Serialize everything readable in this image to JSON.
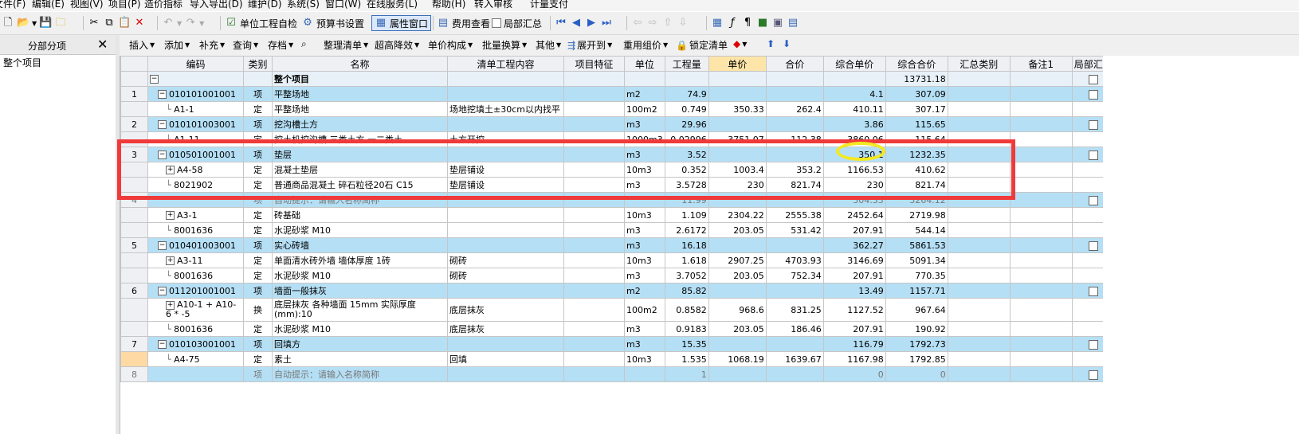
{
  "menu": [
    "文件(F)",
    "编辑(E)",
    "视图(V)",
    "项目(P)",
    "造价指标",
    "导入导出(D)",
    "维护(D)",
    "系统(S)",
    "窗口(W)",
    "在线服务(L)",
    "帮助(H)",
    "转入审核",
    "计量支付"
  ],
  "toolbar": {
    "self_check": "单位工程自检",
    "budget_settings": "预算书设置",
    "property_window": "属性窗口",
    "cost_view": "费用查看",
    "local_summary": "局部汇总"
  },
  "toolbar2": {
    "insert": "插入",
    "add": "添加",
    "supplement": "补充",
    "query": "查询",
    "save": "存档",
    "organize": "整理清单",
    "height_reduce": "超高降效",
    "unit_price_comp": "单价构成",
    "batch_convert": "批量换算",
    "other": "其他",
    "expand": "展开到",
    "reuse_price": "重用组价",
    "lock_list": "锁定清单"
  },
  "left_pane": {
    "title": "分部分项",
    "close": "✕",
    "item": "整个项目"
  },
  "columns": [
    "",
    "编码",
    "类别",
    "名称",
    "清单工程内容",
    "项目特征",
    "单位",
    "工程量",
    "单价",
    "合价",
    "综合单价",
    "综合合价",
    "汇总类别",
    "备注1",
    "局部汇总"
  ],
  "rows": [
    {
      "no": "",
      "code": "",
      "type": "",
      "name": "整个项目",
      "content": "",
      "feature": "",
      "unit": "",
      "qty": "",
      "price": "",
      "total": "",
      "comp_price": "",
      "comp_total": "13731.18"
    },
    {
      "no": "1",
      "code": "010101001001",
      "type": "项",
      "name": "平整场地",
      "content": "",
      "feature": "",
      "unit": "m2",
      "qty": "74.9",
      "price": "",
      "total": "",
      "comp_price": "4.1",
      "comp_total": "307.09"
    },
    {
      "no": "",
      "code": "A1-1",
      "type": "定",
      "name": "平整场地",
      "content": "场地挖填土±30cm以内找平",
      "feature": "",
      "unit": "100m2",
      "qty": "0.749",
      "price": "350.33",
      "total": "262.4",
      "comp_price": "410.11",
      "comp_total": "307.17"
    },
    {
      "no": "2",
      "code": "010101003001",
      "type": "项",
      "name": "挖沟槽土方",
      "content": "",
      "feature": "",
      "unit": "m3",
      "qty": "29.96",
      "price": "",
      "total": "",
      "comp_price": "3.86",
      "comp_total": "115.65"
    },
    {
      "no": "",
      "code": "A1-11",
      "type": "定",
      "name": "挖土机挖沟槽 三类土方 一二类土",
      "content": "土方开挖",
      "feature": "",
      "unit": "1000m3",
      "qty": "0.02996",
      "price": "3751.07",
      "total": "112.38",
      "comp_price": "3860.06",
      "comp_total": "115.64"
    },
    {
      "no": "3",
      "code": "010501001001",
      "type": "项",
      "name": "垫层",
      "content": "",
      "feature": "",
      "unit": "m3",
      "qty": "3.52",
      "price": "",
      "total": "",
      "comp_price": "350.1",
      "comp_total": "1232.35"
    },
    {
      "no": "",
      "code": "A4-58",
      "type": "定",
      "name": "混凝土垫层",
      "content": "垫层铺设",
      "feature": "",
      "unit": "10m3",
      "qty": "0.352",
      "price": "1003.4",
      "total": "353.2",
      "comp_price": "1166.53",
      "comp_total": "410.62"
    },
    {
      "no": "",
      "code": "8021902",
      "type": "定",
      "name": "普通商品混凝土 碎石粒径20石 C15",
      "content": "垫层铺设",
      "feature": "",
      "unit": "m3",
      "qty": "3.5728",
      "price": "230",
      "total": "821.74",
      "comp_price": "230",
      "comp_total": "821.74"
    },
    {
      "no": "4",
      "code": "",
      "type": "项",
      "name": "自动提示：请输入名称简称",
      "content": "",
      "feature": "",
      "unit": "",
      "qty": "11.99",
      "price": "",
      "total": "",
      "comp_price": "304.33",
      "comp_total": "3264.12"
    },
    {
      "no": "",
      "code": "A3-1",
      "type": "定",
      "name": "砖基础",
      "content": "",
      "feature": "",
      "unit": "10m3",
      "qty": "1.109",
      "price": "2304.22",
      "total": "2555.38",
      "comp_price": "2452.64",
      "comp_total": "2719.98"
    },
    {
      "no": "",
      "code": "8001636",
      "type": "定",
      "name": "水泥砂浆 M10",
      "content": "",
      "feature": "",
      "unit": "m3",
      "qty": "2.6172",
      "price": "203.05",
      "total": "531.42",
      "comp_price": "207.91",
      "comp_total": "544.14"
    },
    {
      "no": "5",
      "code": "010401003001",
      "type": "项",
      "name": "实心砖墙",
      "content": "",
      "feature": "",
      "unit": "m3",
      "qty": "16.18",
      "price": "",
      "total": "",
      "comp_price": "362.27",
      "comp_total": "5861.53"
    },
    {
      "no": "",
      "code": "A3-11",
      "type": "定",
      "name": "单面清水砖外墙 墙体厚度 1砖",
      "content": "砌砖",
      "feature": "",
      "unit": "10m3",
      "qty": "1.618",
      "price": "2907.25",
      "total": "4703.93",
      "comp_price": "3146.69",
      "comp_total": "5091.34"
    },
    {
      "no": "",
      "code": "8001636",
      "type": "定",
      "name": "水泥砂浆 M10",
      "content": "砌砖",
      "feature": "",
      "unit": "m3",
      "qty": "3.7052",
      "price": "203.05",
      "total": "752.34",
      "comp_price": "207.91",
      "comp_total": "770.35"
    },
    {
      "no": "6",
      "code": "011201001001",
      "type": "项",
      "name": "墙面一般抹灰",
      "content": "",
      "feature": "",
      "unit": "m2",
      "qty": "85.82",
      "price": "",
      "total": "",
      "comp_price": "13.49",
      "comp_total": "1157.71"
    },
    {
      "no": "",
      "code": "A10-1 + A10-6 * -5",
      "type": "换",
      "name": "底层抹灰 各种墙面 15mm 实际厚度(mm):10",
      "content": "底层抹灰",
      "feature": "",
      "unit": "100m2",
      "qty": "0.8582",
      "price": "968.6",
      "total": "831.25",
      "comp_price": "1127.52",
      "comp_total": "967.64"
    },
    {
      "no": "",
      "code": "8001636",
      "type": "定",
      "name": "水泥砂浆 M10",
      "content": "底层抹灰",
      "feature": "",
      "unit": "m3",
      "qty": "0.9183",
      "price": "203.05",
      "total": "186.46",
      "comp_price": "207.91",
      "comp_total": "190.92"
    },
    {
      "no": "7",
      "code": "010103001001",
      "type": "项",
      "name": "回填方",
      "content": "",
      "feature": "",
      "unit": "m3",
      "qty": "15.35",
      "price": "",
      "total": "",
      "comp_price": "116.79",
      "comp_total": "1792.73"
    },
    {
      "no": "",
      "code": "A4-75",
      "type": "定",
      "name": "素土",
      "content": "回填",
      "feature": "",
      "unit": "10m3",
      "qty": "1.535",
      "price": "1068.19",
      "total": "1639.67",
      "comp_price": "1167.98",
      "comp_total": "1792.85"
    },
    {
      "no": "8",
      "code": "",
      "type": "项",
      "name": "自动提示：请输入名称简称",
      "content": "",
      "feature": "",
      "unit": "",
      "qty": "1",
      "price": "",
      "total": "",
      "comp_price": "0",
      "comp_total": "0"
    }
  ]
}
